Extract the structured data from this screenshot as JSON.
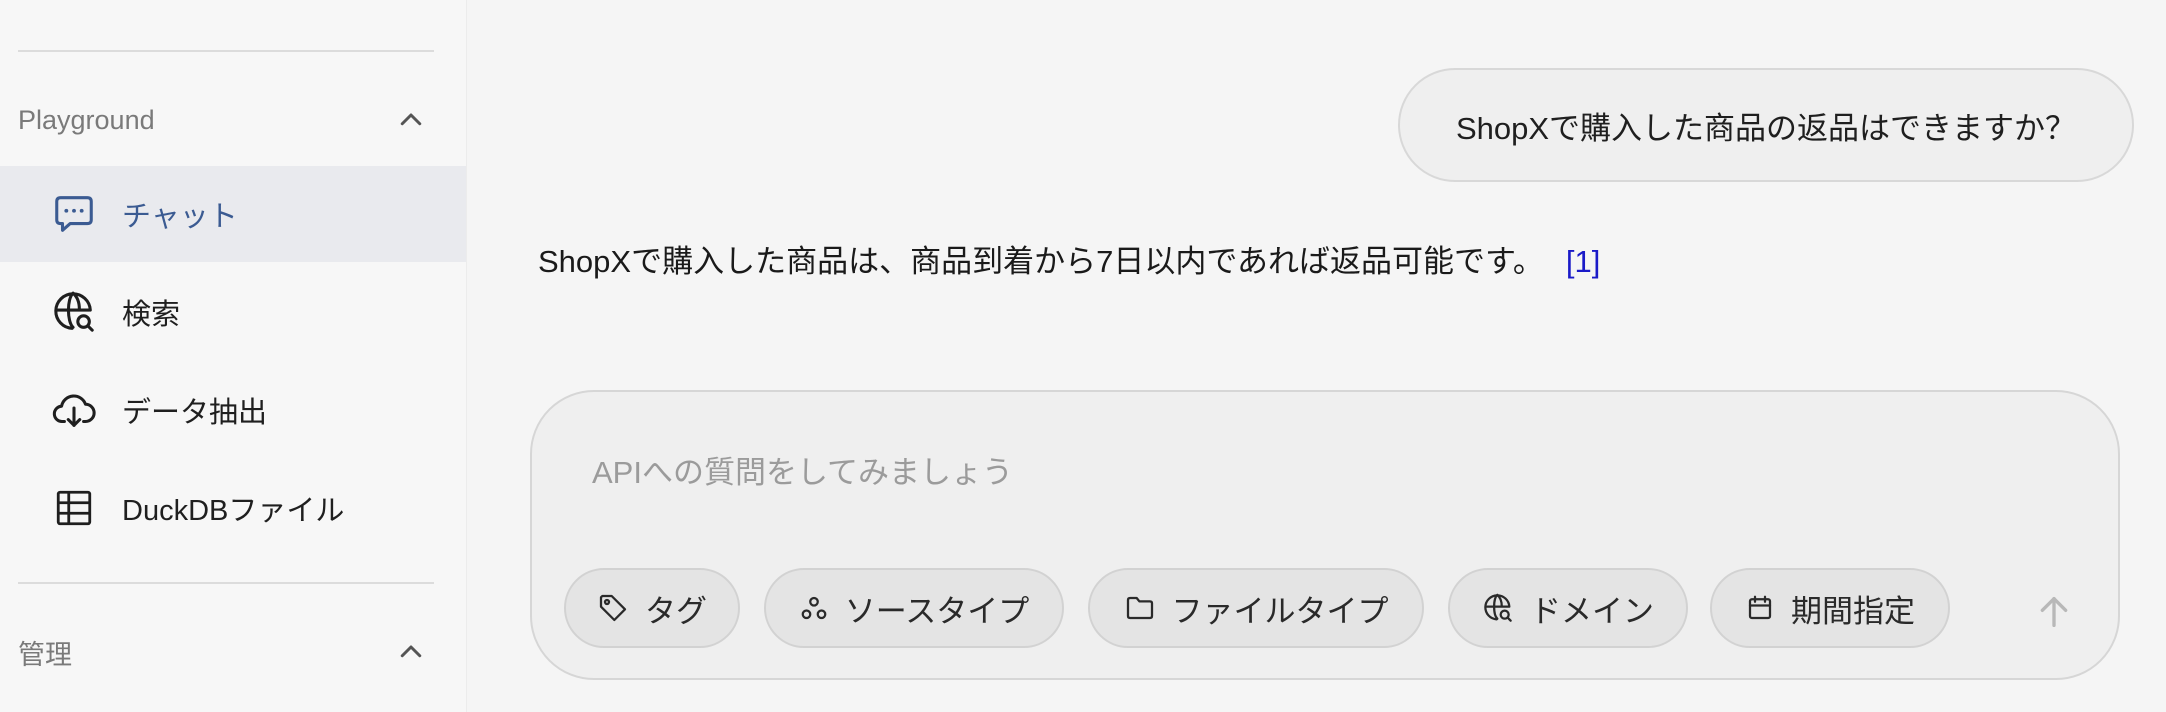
{
  "sidebar": {
    "sections": [
      {
        "label": "Playground",
        "icon": "chevron-up-icon"
      },
      {
        "label": "管理",
        "icon": "chevron-up-icon"
      }
    ],
    "items": [
      {
        "label": "チャット",
        "icon": "chat-bubble-icon",
        "active": true
      },
      {
        "label": "検索",
        "icon": "globe-search-icon"
      },
      {
        "label": "データ抽出",
        "icon": "cloud-download-icon"
      },
      {
        "label": "DuckDBファイル",
        "icon": "table-icon"
      }
    ]
  },
  "chat": {
    "user_message": "ShopXで購入した商品の返品はできますか？",
    "assistant_message": "ShopXで購入した商品は、商品到着から7日以内であれば返品可能です。",
    "citation": "[1]"
  },
  "composer": {
    "placeholder": "APIへの質問をしてみましょう",
    "value": "",
    "filters": [
      {
        "label": "タグ",
        "icon": "tag-icon"
      },
      {
        "label": "ソースタイプ",
        "icon": "source-type-icon"
      },
      {
        "label": "ファイルタイプ",
        "icon": "folder-icon"
      },
      {
        "label": "ドメイン",
        "icon": "globe-search-icon"
      },
      {
        "label": "期間指定",
        "icon": "calendar-icon"
      }
    ],
    "send_icon": "arrow-up-icon"
  },
  "colors": {
    "active_nav_bg": "#e9eaee",
    "active_nav_text": "#3b5b92",
    "citation": "#1a1ac8"
  }
}
